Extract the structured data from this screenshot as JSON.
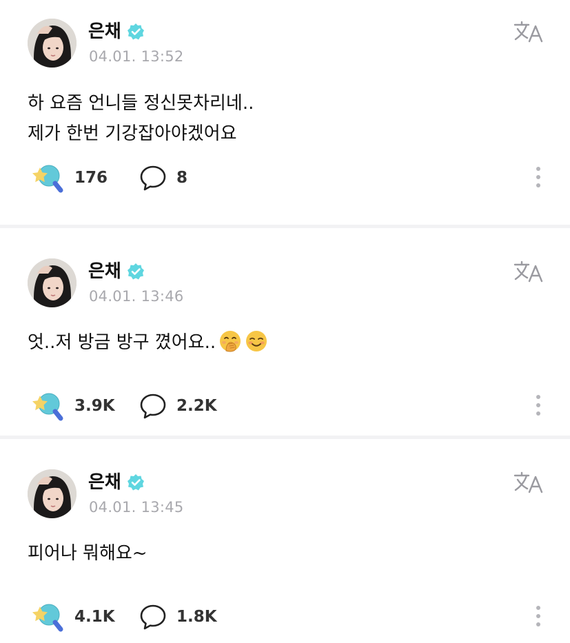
{
  "posts": [
    {
      "author": "은채",
      "timestamp": "04.01. 13:52",
      "text": "하 요즘 언니들 정신못차리네..\n제가 한번 기강잡아야겠어요",
      "emojis": [],
      "likes": "176",
      "comments": "8"
    },
    {
      "author": "은채",
      "timestamp": "04.01. 13:46",
      "text": "엇..저 방금 방구 꼈어요..",
      "emojis": [
        "face-with-hand-over-mouth",
        "smiling-face"
      ],
      "likes": "3.9K",
      "comments": "2.2K"
    },
    {
      "author": "은채",
      "timestamp": "04.01. 13:45",
      "text": "피어나 뭐해요~",
      "emojis": [],
      "likes": "4.1K",
      "comments": "1.8K"
    }
  ],
  "icons": {
    "verified": "verified-badge-icon",
    "translate": "translate-icon",
    "like": "star-like-icon",
    "comment": "comment-bubble-icon",
    "more": "more-vertical-icon"
  },
  "colors": {
    "verified": "#5fd6e0",
    "timestamp": "#a8a8ad",
    "divider": "#f2f2f4",
    "like_bubble": "#62c9d9",
    "like_star": "#f5d365",
    "like_handle": "#4b6fd8"
  }
}
